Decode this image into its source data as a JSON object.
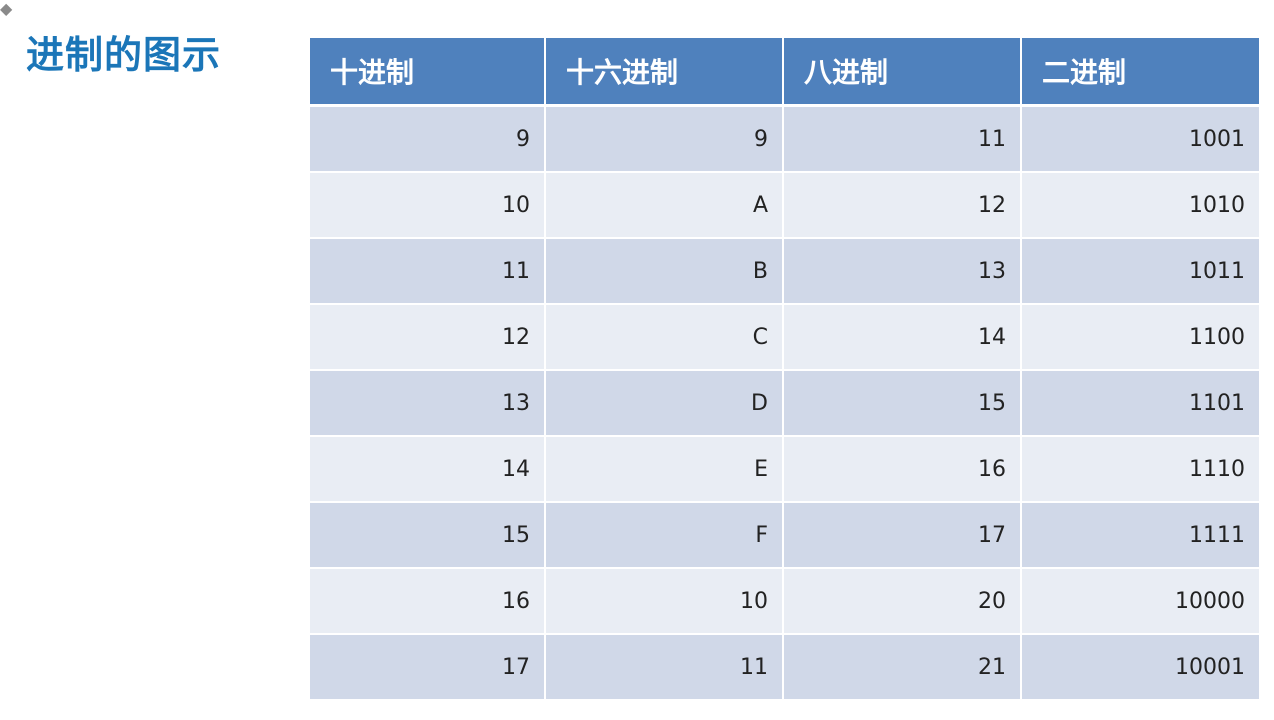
{
  "slide": {
    "title": "进制的图示"
  },
  "table": {
    "headers": [
      "十进制",
      "十六进制",
      "八进制",
      "二进制"
    ],
    "rows": [
      [
        "9",
        "9",
        "11",
        "1001"
      ],
      [
        "10",
        "A",
        "12",
        "1010"
      ],
      [
        "11",
        "B",
        "13",
        "1011"
      ],
      [
        "12",
        "C",
        "14",
        "1100"
      ],
      [
        "13",
        "D",
        "15",
        "1101"
      ],
      [
        "14",
        "E",
        "16",
        "1110"
      ],
      [
        "15",
        "F",
        "17",
        "1111"
      ],
      [
        "16",
        "10",
        "20",
        "10000"
      ],
      [
        "17",
        "11",
        "21",
        "10001"
      ]
    ]
  },
  "colors": {
    "title": "#1b76b8",
    "header_bg": "#4f81bd",
    "row_odd": "#d0d8e8",
    "row_even": "#e9edf4"
  },
  "icons": {
    "bullet": "bullet-icon"
  }
}
